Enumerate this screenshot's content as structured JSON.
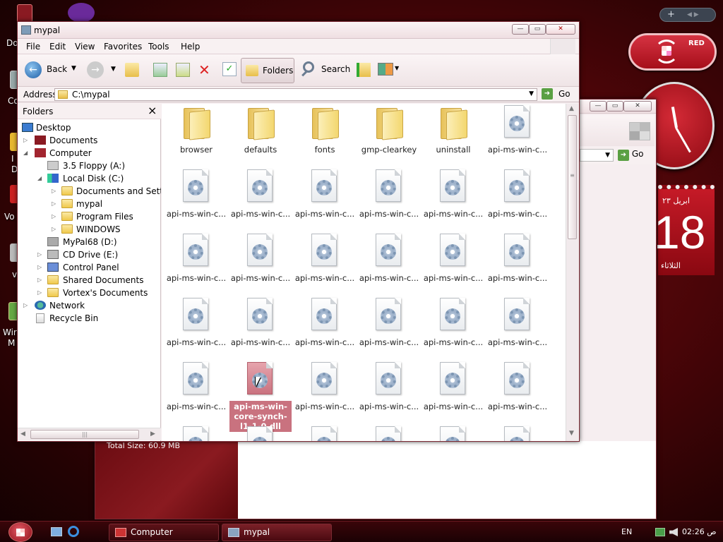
{
  "desktop": {
    "icon_labels_partial": [
      "Do",
      "Co",
      "I",
      "D",
      "Vo",
      "v",
      "Wir",
      "M"
    ]
  },
  "sidebar": {
    "top_buttons": {
      "add": "+",
      "nav": "◀ ▶"
    },
    "badge": {
      "text": "RED"
    },
    "calendar": {
      "month": "ابريل ٢٣",
      "day": "18",
      "weekday": "الثلاثاء"
    }
  },
  "window": {
    "title": "mypal",
    "menu": [
      "File",
      "Edit",
      "View",
      "Favorites",
      "Tools",
      "Help"
    ],
    "toolbar": {
      "back": "Back",
      "folders": "Folders",
      "search": "Search"
    },
    "address": {
      "label": "Address",
      "value": "C:\\mypal",
      "go": "Go"
    },
    "folders_pane": {
      "title": "Folders",
      "close": "×",
      "items": [
        {
          "label": "Desktop"
        },
        {
          "label": "Documents"
        },
        {
          "label": "Computer"
        },
        {
          "label": "3.5 Floppy (A:)"
        },
        {
          "label": "Local Disk (C:)"
        },
        {
          "label": "Documents and Settings"
        },
        {
          "label": "mypal"
        },
        {
          "label": "Program Files"
        },
        {
          "label": "WINDOWS"
        },
        {
          "label": "MyPal68 (D:)"
        },
        {
          "label": "CD Drive (E:)"
        },
        {
          "label": "Control Panel"
        },
        {
          "label": "Shared Documents"
        },
        {
          "label": "Vortex's Documents"
        },
        {
          "label": "Network"
        },
        {
          "label": "Recycle Bin"
        }
      ]
    },
    "files": {
      "folders": [
        "browser",
        "defaults",
        "fonts",
        "gmp-clearkey",
        "uninstall"
      ],
      "generic_label": "api-ms-win-c...",
      "selected_label": "api-ms-win-core-synch-l1-1-0.dll"
    }
  },
  "back_window": {
    "go": "Go",
    "status": "Total Size: 60.9 MB"
  },
  "taskbar": {
    "items": [
      {
        "label": "Computer"
      },
      {
        "label": "mypal"
      }
    ],
    "lang": "EN",
    "time": "02:26 ص"
  }
}
